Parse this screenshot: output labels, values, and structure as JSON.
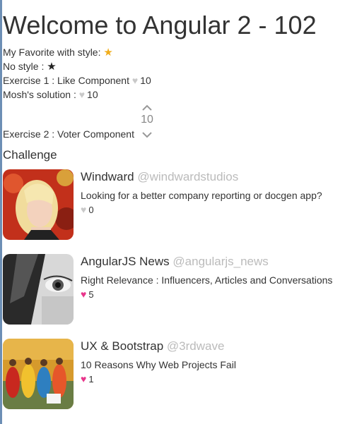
{
  "page_title": "Welcome to Angular 2 - 102",
  "favorite_section": {
    "styled_label": "My Favorite with style:",
    "styled_icon": "star-filled-icon",
    "plain_label": "No style :",
    "plain_icon": "star-filled-icon"
  },
  "exercise1": {
    "label": "Exercise 1 : Like Component",
    "likes": "10"
  },
  "mosh_solution": {
    "label": "Mosh's solution :",
    "likes": "10"
  },
  "exercise2": {
    "label": "Exercise 2 : Voter Component",
    "votes": "10"
  },
  "challenge": {
    "heading": "Challenge",
    "tweets": [
      {
        "name": "Windward",
        "handle": "@windwardstudios",
        "text": "Looking for a better company reporting or docgen app?",
        "likes": "0",
        "liked": false
      },
      {
        "name": "AngularJS News",
        "handle": "@angularjs_news",
        "text": "Right Relevance : Influencers, Articles and Conversations",
        "likes": "5",
        "liked": true
      },
      {
        "name": "UX & Bootstrap",
        "handle": "@3rdwave",
        "text": "10 Reasons Why Web Projects Fail",
        "likes": "1",
        "liked": true
      }
    ]
  },
  "colors": {
    "star_gold": "#f0ad1b",
    "heart_gray": "#c9c9c9",
    "heart_pink": "#e8358b",
    "handle_gray": "#bbbbbb"
  }
}
